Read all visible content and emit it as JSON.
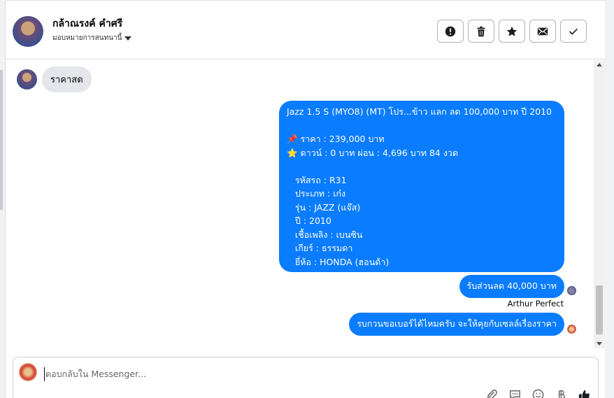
{
  "header": {
    "contact_name": "กล้าณรงค์ คำศรี",
    "assign_label": "มอบหมายการสนทนานี้"
  },
  "actions": [
    {
      "name": "report-icon"
    },
    {
      "name": "trash-icon"
    },
    {
      "name": "star-icon"
    },
    {
      "name": "mail-icon"
    },
    {
      "name": "check-icon"
    }
  ],
  "messages": {
    "incoming_1": "ราคาสด",
    "outgoing_listing": "Jazz 1.5 S (MYO8) (MT) โปร...ข้าว แลก ลด 100,000 บาท ปี 2010\n\n📌 ราคา : 239,000 บาท\n⭐ ดาวน์ : 0 บาท ผ่อน : 4,696 บาท 84 งวด\n\n   รหัสรถ : R31\n   ประเภท : เก๋ง\n   รุ่น : JAZZ (แจ๊ส)\n   ปี : 2010\n   เชื้อเพลิง : เบนซิน\n   เกียร์ : ธรรมดา\n   ยี่ห้อ : HONDA (ฮอนด้า)",
    "outgoing_discount": "รับส่วนลด 40,000 บาท",
    "sender_name": "Arthur Perfect",
    "outgoing_question": "รบกวนขอเบอร์ได้ไหมครับ จะให้คุยกับเซลล์เรื่องราคา"
  },
  "composer": {
    "placeholder": "ตอบกลับใน Messenger..."
  },
  "colors": {
    "accent": "#0a7cff",
    "incoming_bubble": "#e4e6eb"
  }
}
